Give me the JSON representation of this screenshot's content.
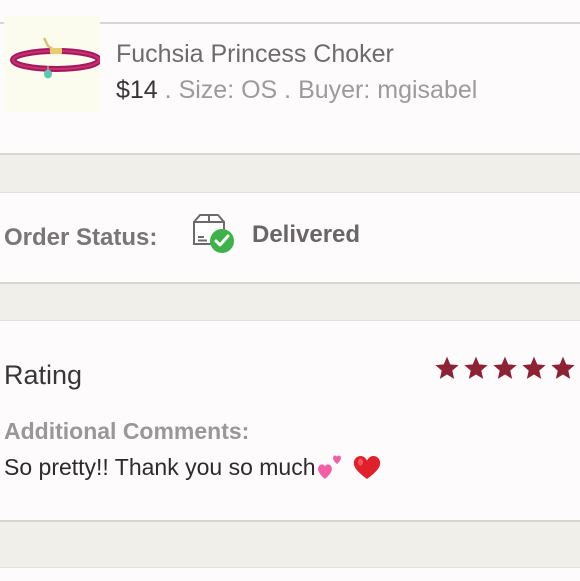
{
  "item": {
    "title": "Fuchsia Princess Choker",
    "price": "$14",
    "separator": " . ",
    "size": "Size: OS",
    "buyer": "Buyer: mgisabel",
    "thumbnail_icon": "choker-necklace-image"
  },
  "order_status": {
    "label": "Order Status:",
    "value": "Delivered",
    "icon": "delivered-box-icon",
    "accent_color": "#3db24a"
  },
  "rating": {
    "label": "Rating",
    "stars": 5,
    "max_stars": 5,
    "star_color": "#8c2233"
  },
  "comments": {
    "label": "Additional Comments:",
    "text": "So pretty!! Thank you so much",
    "emojis": [
      "two-hearts-emoji",
      "red-heart-emoji"
    ]
  }
}
